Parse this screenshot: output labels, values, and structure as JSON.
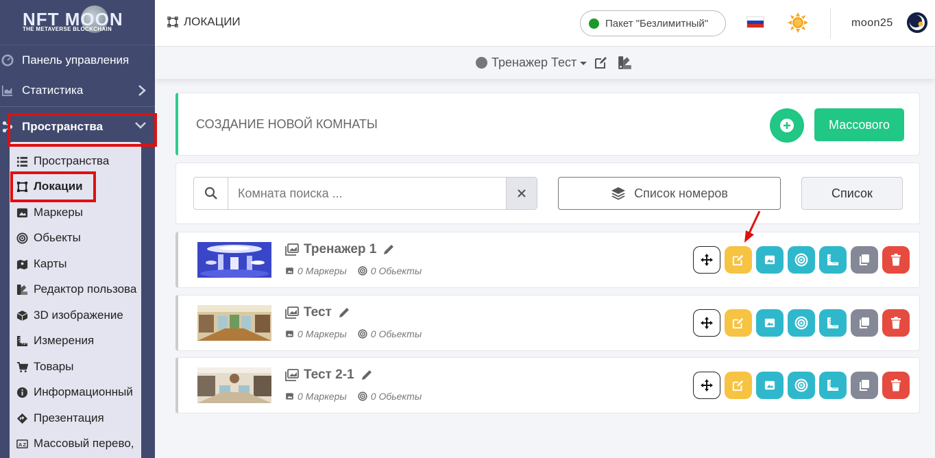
{
  "sidebar": {
    "logo": {
      "main": "NFT MOON",
      "sub": "THE METAVERSE BLOCKCHAIN"
    },
    "items": [
      {
        "label": "Панель управления",
        "icon": "dashboard-icon"
      },
      {
        "label": "Статистика",
        "icon": "chart-icon"
      },
      {
        "label": "Пространства",
        "icon": "network-icon"
      }
    ],
    "submenu": [
      {
        "label": "Пространства",
        "icon": "list-icon"
      },
      {
        "label": "Локации",
        "icon": "vector-square-icon"
      },
      {
        "label": "Маркеры",
        "icon": "image-icon"
      },
      {
        "label": "Обьекты",
        "icon": "target-icon"
      },
      {
        "label": "Карты",
        "icon": "map-icon"
      },
      {
        "label": "Редактор пользова",
        "icon": "swatch-icon"
      },
      {
        "label": "3D изображение",
        "icon": "cube-icon"
      },
      {
        "label": "Измерения",
        "icon": "ruler-icon"
      },
      {
        "label": "Товары",
        "icon": "cart-icon"
      },
      {
        "label": "Информационный",
        "icon": "info-icon"
      },
      {
        "label": "Презентация",
        "icon": "diamond-arrow-icon"
      },
      {
        "label": "Массовый перево,",
        "icon": "translate-icon"
      }
    ]
  },
  "header": {
    "title": "ЛОКАЦИИ",
    "package": "Пакет \"Безлимитный\"",
    "username": "moon25",
    "space_name": "Тренажер Тест"
  },
  "create": {
    "title": "СОЗДАНИЕ НОВОЙ КОМНАТЫ",
    "mass_label": "Массового"
  },
  "search": {
    "placeholder": "Комната поиска ...",
    "rooms_list_label": "Список номеров",
    "list_label": "Список"
  },
  "rooms": [
    {
      "name": "Тренажер 1",
      "markers": "Маркеры",
      "objects": "Обьекты",
      "count_markers": "0",
      "count_objects": "0"
    },
    {
      "name": "Тест",
      "markers": "Маркеры",
      "objects": "Обьекты",
      "count_markers": "0",
      "count_objects": "0"
    },
    {
      "name": "Тест 2-1",
      "markers": "Маркеры",
      "objects": "Обьекты",
      "count_markers": "0",
      "count_objects": "0"
    }
  ],
  "colors": {
    "accent": "#21c784",
    "sidebar": "#414a6e",
    "highlight": "#e01010",
    "edit": "#f6c342",
    "teal": "#2fb8cb",
    "delete": "#e54b3f"
  }
}
